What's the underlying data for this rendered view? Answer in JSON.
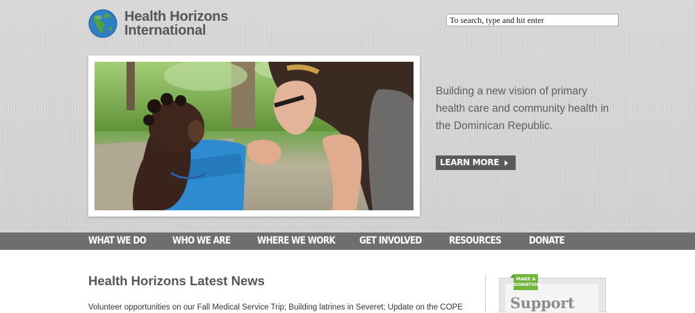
{
  "header": {
    "logo_line1": "Health Horizons",
    "logo_line2": "International",
    "search_placeholder": "To search, type and hit enter"
  },
  "hero": {
    "tagline": "Building a new vision of primary health care and community health in the Dominican Republic.",
    "learn_more_label": "LEARN MORE",
    "photo_description_icon": "child-and-volunteer-photo"
  },
  "nav": {
    "items": [
      {
        "label": "WHAT WE DO"
      },
      {
        "label": "WHO WE ARE"
      },
      {
        "label": "WHERE WE WORK"
      },
      {
        "label": "GET INVOLVED"
      },
      {
        "label": "RESOURCES"
      },
      {
        "label": "DONATE"
      }
    ]
  },
  "news": {
    "title": "Health Horizons Latest News",
    "snippet": "Volunteer opportunities on our Fall Medical Service Trip; Building latrines in Severet; Update on the COPE"
  },
  "sidebar": {
    "donate_tag_line1": "MAKE A",
    "donate_tag_line2": "DONATION",
    "support_label": "Support"
  },
  "colors": {
    "nav_bg": "#6e6e6e",
    "accent_green": "#6fb53a",
    "header_bg": "#d6d6d6",
    "text_gray": "#555555"
  }
}
